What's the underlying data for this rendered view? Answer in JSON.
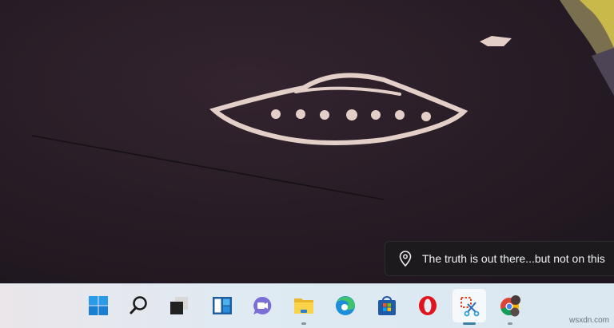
{
  "wallpaper": {
    "name": "UFO petroglyph rock",
    "colors": {
      "rock": "#2a1f29",
      "glyph": "#e3cfc8",
      "lichen": "#c9b94a"
    }
  },
  "spotlight": {
    "icon": "location-pin-icon",
    "text": "The truth is out there...but not on this"
  },
  "taskbar": {
    "items": [
      {
        "name": "start",
        "icon": "windows-logo-icon"
      },
      {
        "name": "search",
        "icon": "search-icon"
      },
      {
        "name": "task-view",
        "icon": "task-view-icon"
      },
      {
        "name": "widgets",
        "icon": "widgets-icon"
      },
      {
        "name": "teams-chat",
        "icon": "chat-icon"
      },
      {
        "name": "file-explorer",
        "icon": "folder-icon",
        "running": true
      },
      {
        "name": "edge",
        "icon": "edge-icon"
      },
      {
        "name": "microsoft-store",
        "icon": "store-icon"
      },
      {
        "name": "opera",
        "icon": "opera-icon"
      },
      {
        "name": "snipping-tool",
        "icon": "snipping-tool-icon",
        "active": true
      },
      {
        "name": "chrome",
        "icon": "chrome-icon",
        "running": true
      }
    ]
  },
  "watermark": "wsxdn.com"
}
